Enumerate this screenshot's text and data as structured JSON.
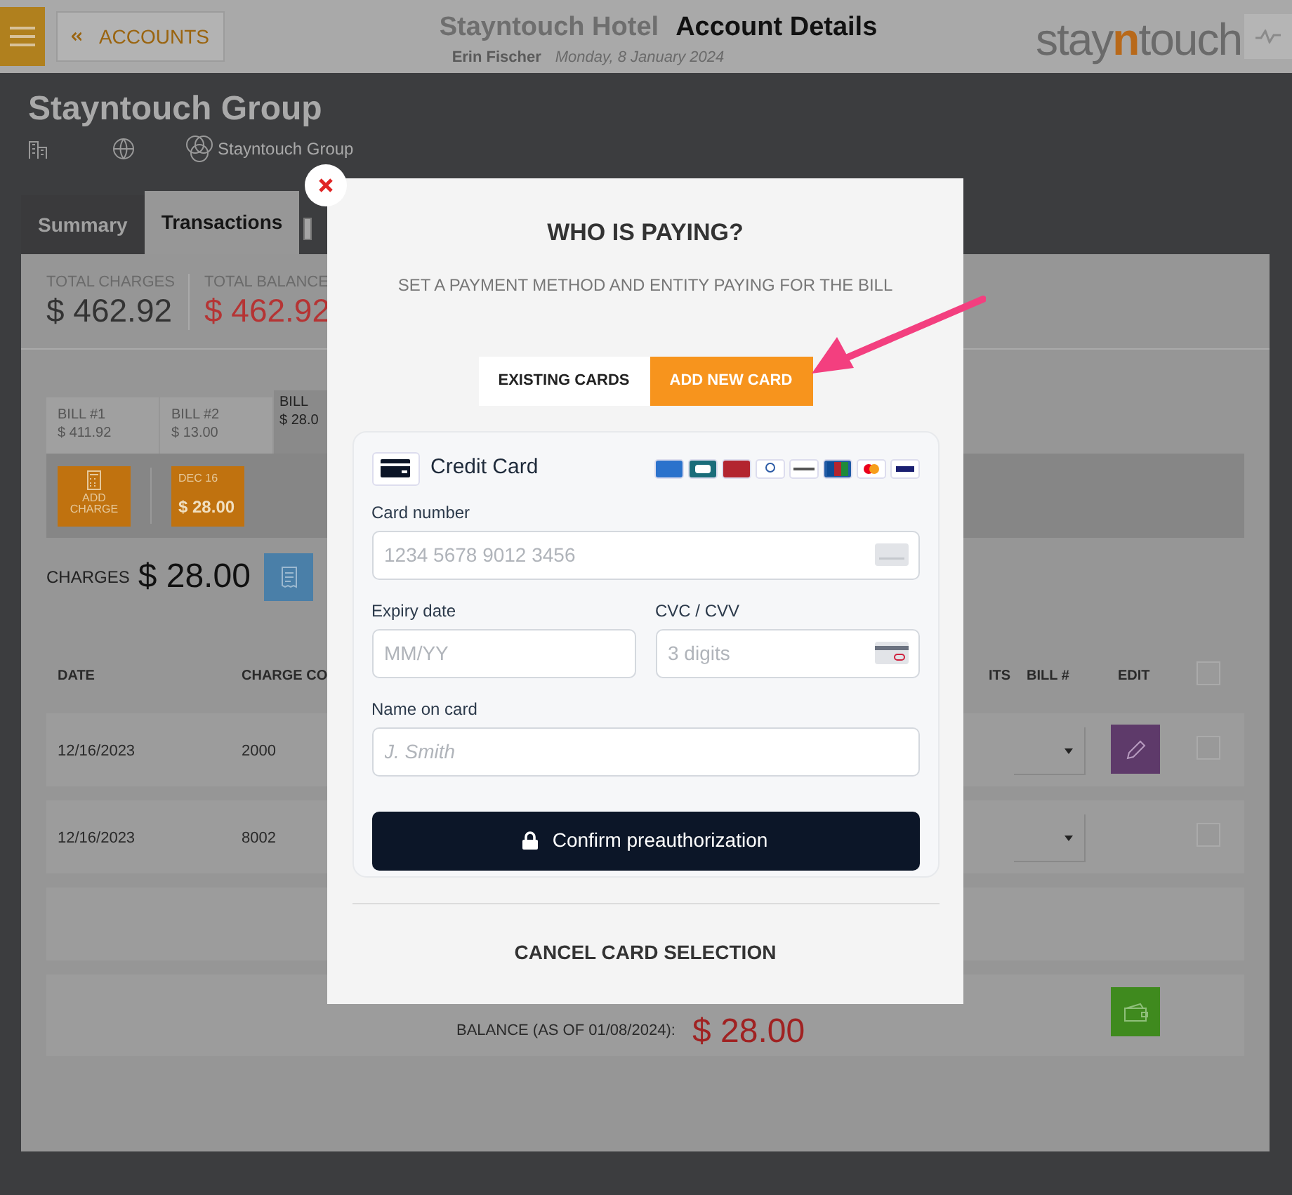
{
  "header": {
    "back_button": "ACCOUNTS",
    "hotel": "Stayntouch Hotel",
    "title": "Account Details",
    "user": "Erin Fischer",
    "date": "Monday, 8 January 2024",
    "logo": [
      "stay",
      "n",
      "touch"
    ]
  },
  "account": {
    "name": "Stayntouch Group",
    "parent": "Stayntouch Group"
  },
  "tabs": [
    {
      "label": "Summary",
      "selected": false
    },
    {
      "label": "Transactions",
      "selected": true
    }
  ],
  "totals": [
    {
      "label": "TOTAL CHARGES",
      "value": "$ 462.92",
      "kind": "charges"
    },
    {
      "label": "TOTAL BALANCE",
      "value": "$ 462.92",
      "kind": "balance"
    }
  ],
  "bills": [
    {
      "label": "BILL #1",
      "amount": "$ 411.92",
      "selected": false
    },
    {
      "label": "BILL #2",
      "amount": "$ 13.00",
      "selected": false
    },
    {
      "label": "BILL",
      "amount": "$ 28.0",
      "selected": true
    }
  ],
  "add_charge": "ADD CHARGE",
  "date_card": {
    "date": "DEC 16",
    "amount": "$ 28.00"
  },
  "charges": {
    "label": "CHARGES",
    "amount": "$ 28.00"
  },
  "table": {
    "columns_left": [
      "DATE",
      "CHARGE CO"
    ],
    "columns_right": [
      "ITS",
      "BILL #",
      "EDIT"
    ],
    "select_all_checked": false,
    "rows": [
      {
        "date": "12/16/2023",
        "code": "2000",
        "editable": true,
        "checked": false
      },
      {
        "date": "12/16/2023",
        "code": "8002",
        "editable": false,
        "checked": false
      }
    ],
    "balance_label": "BALANCE (AS OF 01/08/2024):",
    "balance_value": "$ 28.00"
  },
  "modal": {
    "title": "WHO IS PAYING?",
    "subtitle": "SET A PAYMENT METHOD AND ENTITY PAYING FOR THE BILL",
    "tabs": [
      {
        "label": "EXISTING CARDS",
        "selected": false
      },
      {
        "label": "ADD NEW CARD",
        "selected": true
      }
    ],
    "method": "Credit Card",
    "fields": [
      {
        "label": "Card number",
        "placeholder": "1234 5678 9012 3456"
      },
      {
        "label": "Expiry date",
        "placeholder": "MM/YY"
      },
      {
        "label": "CVC / CVV",
        "placeholder": "3 digits"
      },
      {
        "label": "Name on card",
        "placeholder": "J. Smith"
      }
    ],
    "confirm": "Confirm preauthorization",
    "cancel": "CANCEL CARD SELECTION"
  }
}
